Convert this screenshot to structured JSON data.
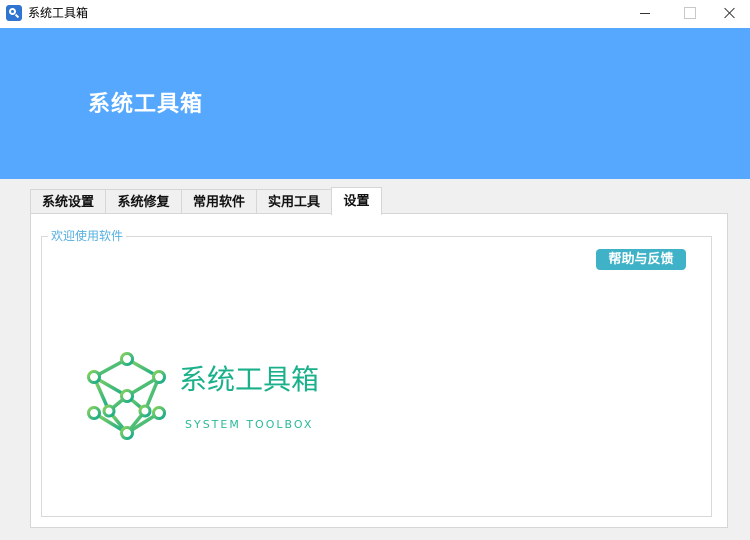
{
  "window": {
    "title": "系统工具箱"
  },
  "banner": {
    "title": "系统工具箱"
  },
  "tabs": [
    {
      "label": "系统设置"
    },
    {
      "label": "系统修复"
    },
    {
      "label": "常用软件"
    },
    {
      "label": "实用工具"
    },
    {
      "label": "设置",
      "active": true
    }
  ],
  "panel": {
    "group_title": "欢迎使用软件",
    "help_button": "帮助与反馈",
    "logo": {
      "name": "系统工具箱",
      "subtitle": "SYSTEM TOOLBOX",
      "icon": "hexagon-network-icon"
    }
  },
  "colors": {
    "banner": "#55a8fe",
    "accent": "#3fb2c8",
    "logo_green": "#1ab08a",
    "group_title": "#55b0e0"
  }
}
